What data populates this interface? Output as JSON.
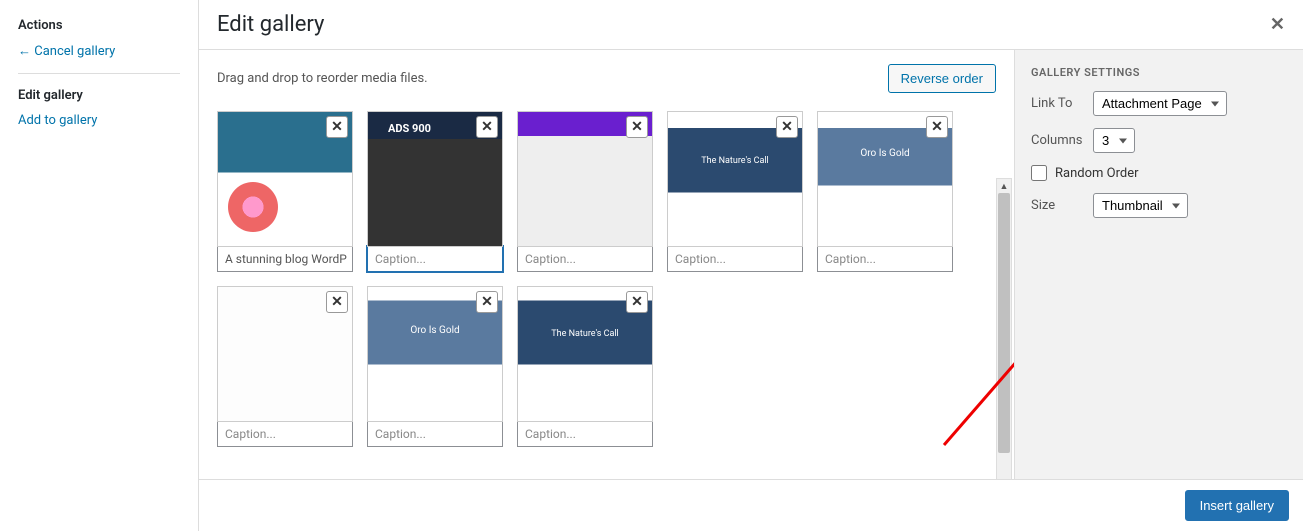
{
  "sidebar": {
    "actions_heading": "Actions",
    "cancel_link": "Cancel gallery",
    "edit_current": "Edit gallery",
    "add_link": "Add to gallery"
  },
  "header": {
    "title": "Edit gallery"
  },
  "toolbar": {
    "hint": "Drag and drop to reorder media files.",
    "reverse_label": "Reverse order"
  },
  "items": [
    {
      "caption": "A stunning blog WordP",
      "placeholder": false,
      "focused": false
    },
    {
      "caption": "Caption...",
      "placeholder": true,
      "focused": true
    },
    {
      "caption": "Caption...",
      "placeholder": true,
      "focused": false
    },
    {
      "caption": "Caption...",
      "placeholder": true,
      "focused": false
    },
    {
      "caption": "Caption...",
      "placeholder": true,
      "focused": false
    },
    {
      "caption": "Caption...",
      "placeholder": true,
      "focused": false
    },
    {
      "caption": "Caption...",
      "placeholder": true,
      "focused": false
    },
    {
      "caption": "Caption...",
      "placeholder": true,
      "focused": false
    }
  ],
  "settings": {
    "heading": "GALLERY SETTINGS",
    "link_to_label": "Link To",
    "link_to_value": "Attachment Page",
    "columns_label": "Columns",
    "columns_value": "3",
    "random_label": "Random Order",
    "size_label": "Size",
    "size_value": "Thumbnail"
  },
  "footer": {
    "insert_label": "Insert gallery"
  }
}
